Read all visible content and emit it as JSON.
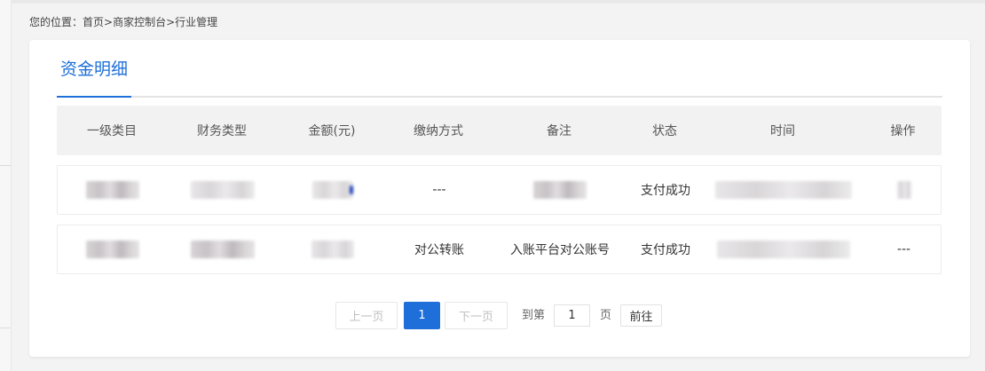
{
  "breadcrumb": {
    "prefix": "您的位置：",
    "home": "首页",
    "sep1": ">",
    "console": "商家控制台",
    "sep2": ">",
    "current": "行业管理"
  },
  "tabs": [
    {
      "label": "资金明细",
      "active": true
    }
  ],
  "table": {
    "headers": [
      "一级类目",
      "财务类型",
      "金额(元)",
      "缴纳方式",
      "备注",
      "状态",
      "时间",
      "操作"
    ],
    "rows": [
      {
        "category": "",
        "finance_type": "",
        "amount": "",
        "payment_method": "---",
        "remark": "",
        "status": "支付成功",
        "time": "",
        "action": ""
      },
      {
        "category": "",
        "finance_type": "",
        "amount": "",
        "payment_method": "对公转账",
        "remark": "入账平台对公账号",
        "status": "支付成功",
        "time": "",
        "action": "---"
      }
    ]
  },
  "pagination": {
    "prev_label": "上一页",
    "current_page": "1",
    "next_label": "下一页",
    "goto_prefix": "到第",
    "goto_value": "1",
    "goto_suffix": "页",
    "go_label": "前往"
  },
  "colors": {
    "accent": "#1e6fd9",
    "header_bg": "#f2f2f2",
    "page_bg": "#f3f3f3"
  }
}
